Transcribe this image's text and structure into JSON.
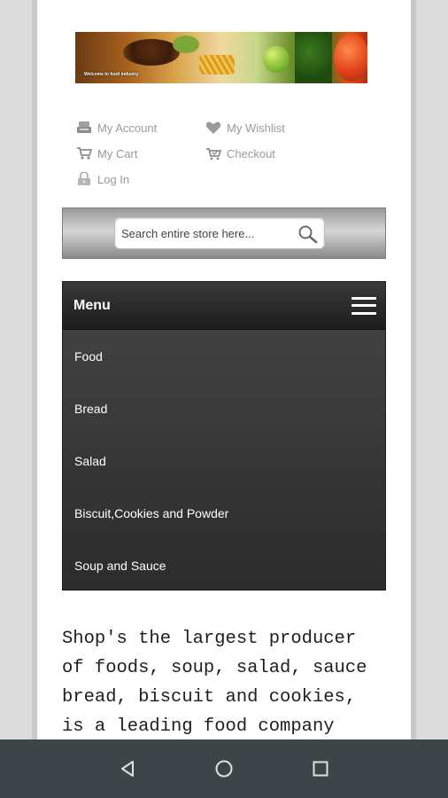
{
  "banner": {
    "caption": "Welcome to food industry"
  },
  "links": {
    "my_account": "My Account",
    "my_wishlist": "My Wishlist",
    "my_cart": "My Cart",
    "checkout": "Checkout",
    "log_in": "Log In"
  },
  "search": {
    "placeholder": "Search entire store here..."
  },
  "menu": {
    "title": "Menu",
    "items": [
      {
        "label": "Food"
      },
      {
        "label": "Bread"
      },
      {
        "label": "Salad"
      },
      {
        "label": "Biscuit,Cookies and Powder"
      },
      {
        "label": "Soup and Sauce"
      }
    ]
  },
  "intro_text": "Shop's the largest producer\nof foods, soup, salad, sauce\nbread, biscuit and cookies,\nis a leading food company",
  "colors": {
    "menu_bg": "#2c2c2c",
    "link_text": "#9a9a9a",
    "navbar_bg": "#3d4548"
  },
  "navbar": {
    "back_icon": "back-triangle-icon",
    "home_icon": "home-circle-icon",
    "recents_icon": "recents-square-icon"
  }
}
